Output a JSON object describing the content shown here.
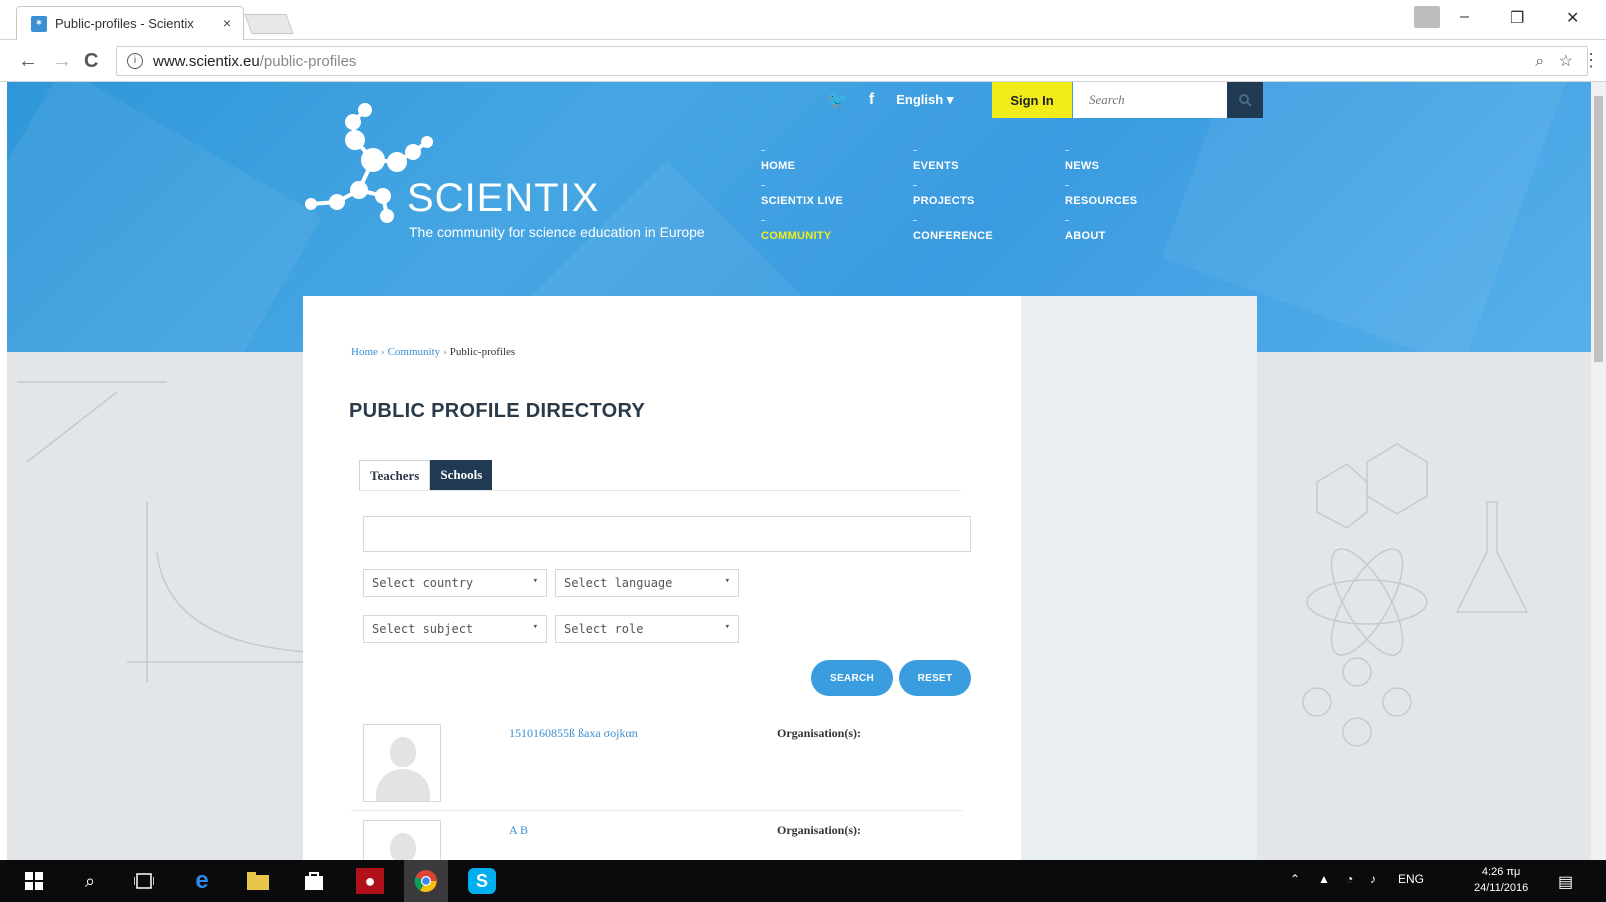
{
  "browser": {
    "tab_title": "Public-profiles - Scientix",
    "tab_close": "×",
    "url_host": "www.scientix.eu",
    "url_path": "/public-profiles",
    "back_glyph": "←",
    "forward_glyph": "→",
    "reload_glyph": "C",
    "info_glyph": "i",
    "min_glyph": "–",
    "restore_glyph": "❐",
    "close_glyph": "✕",
    "menu_glyph": "⋮",
    "zoom_glyph": "⌕",
    "star_glyph": "☆"
  },
  "site": {
    "logo": "SCIENTIX",
    "tagline": "The community for science education in Europe",
    "utility": {
      "twitter_glyph": "🐦",
      "facebook_glyph": "f",
      "language": "English",
      "language_arrow": "▾",
      "sign_in": "Sign In",
      "search_placeholder": "Search"
    },
    "nav": [
      {
        "label": "HOME",
        "active": false
      },
      {
        "label": "EVENTS",
        "active": false
      },
      {
        "label": "NEWS",
        "active": false
      },
      {
        "label": "SCIENTIX LIVE",
        "active": false
      },
      {
        "label": "PROJECTS",
        "active": false
      },
      {
        "label": "RESOURCES",
        "active": false
      },
      {
        "label": "COMMUNITY",
        "active": true
      },
      {
        "label": "CONFERENCE",
        "active": false
      },
      {
        "label": "ABOUT",
        "active": false
      }
    ]
  },
  "page": {
    "breadcrumb": {
      "home": "Home",
      "sep": "›",
      "community": "Community",
      "current": "Public-profiles"
    },
    "title": "PUBLIC PROFILE DIRECTORY",
    "tabs": {
      "teachers": "Teachers",
      "schools": "Schools"
    },
    "filters": {
      "country": "Select country",
      "language": "Select language",
      "subject": "Select subject",
      "role": "Select role",
      "arrow": "▾"
    },
    "buttons": {
      "search": "SEARCH",
      "reset": "RESET"
    },
    "results": [
      {
        "name": "1510160855ß ßaxa σοjkαn",
        "org_label": "Organisation(s):"
      },
      {
        "name": "A B",
        "org_label": "Organisation(s):"
      }
    ]
  },
  "taskbar": {
    "lang": "ENG",
    "time": "4:26 πμ",
    "date": "24/11/2016"
  },
  "colors": {
    "hero_blue": "#3a9be0",
    "signin_yellow": "#f2ed1a",
    "dark_navy": "#1f3a52",
    "active_nav": "#f2ed1a",
    "button_blue": "#3a9de0"
  }
}
